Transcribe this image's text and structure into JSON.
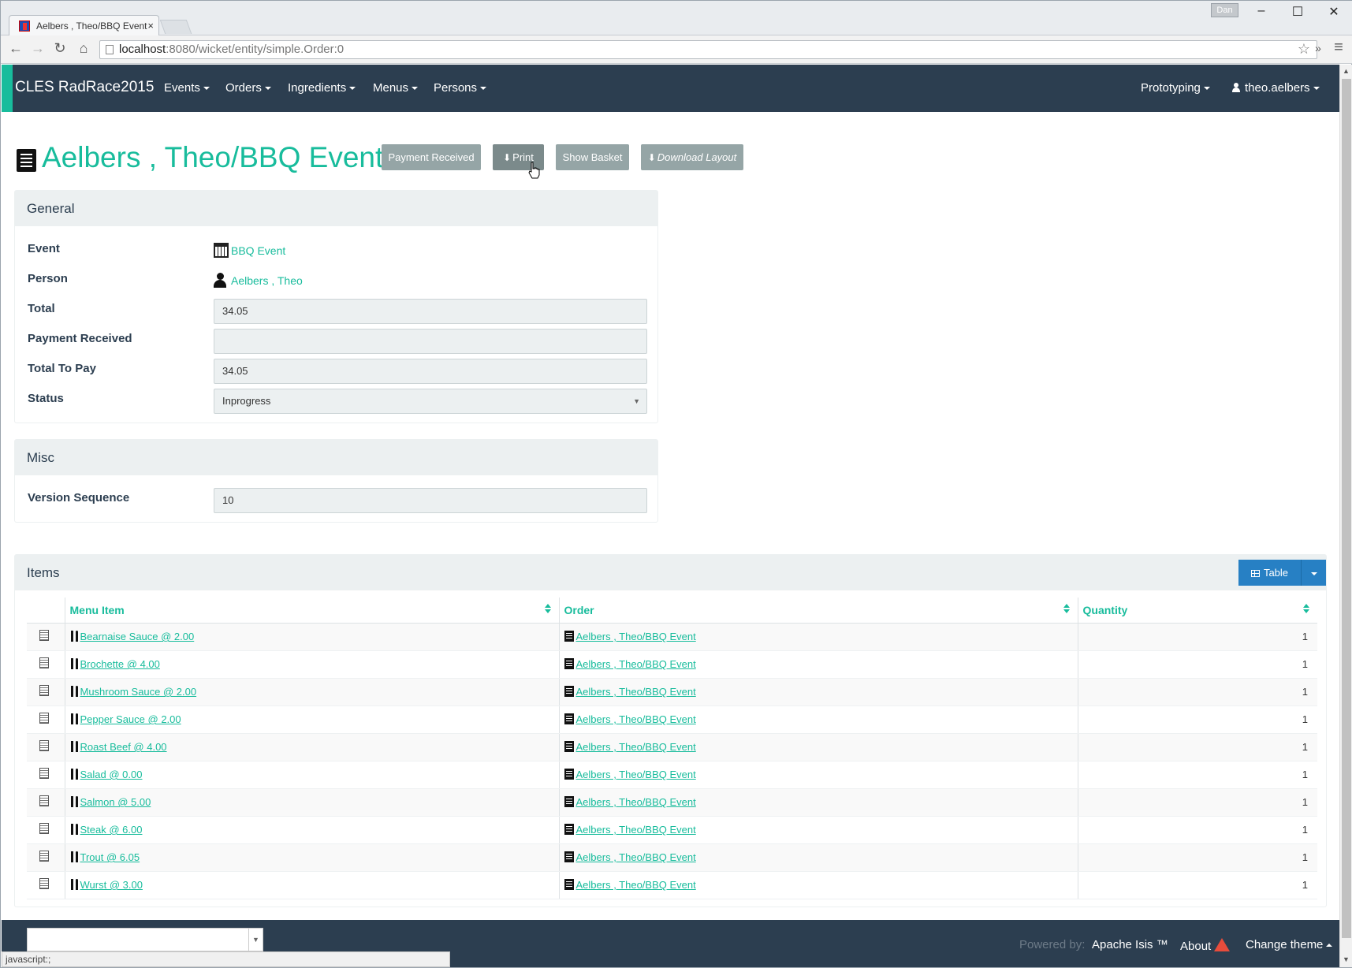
{
  "browser": {
    "tab_title": "Aelbers , Theo/BBQ Event",
    "tab_close": "×",
    "profile_name": "Dan",
    "url_host": "localhost",
    "url_path": ":8080/wicket/entity/simple.Order:0",
    "overflow": "»",
    "menu": "≡",
    "status_text": "javascript:;"
  },
  "nav": {
    "brand": "CLES RadRace2015",
    "menus": [
      "Events",
      "Orders",
      "Ingredients",
      "Menus",
      "Persons"
    ],
    "prototyping": "Prototyping",
    "user": "theo.aelbers"
  },
  "header": {
    "title": "Aelbers , Theo/BBQ Event",
    "actions": {
      "payment_received": "Payment Received",
      "print": "Print",
      "show_basket": "Show Basket",
      "download_layout": "Download Layout"
    }
  },
  "general": {
    "heading": "General",
    "event_label": "Event",
    "event_value": "BBQ Event",
    "person_label": "Person",
    "person_value": "Aelbers , Theo",
    "total_label": "Total",
    "total_value": "34.05",
    "payment_label": "Payment Received",
    "payment_value": "",
    "total_to_pay_label": "Total To Pay",
    "total_to_pay_value": "34.05",
    "status_label": "Status",
    "status_value": "Inprogress"
  },
  "misc": {
    "heading": "Misc",
    "version_label": "Version Sequence",
    "version_value": "10"
  },
  "items": {
    "heading": "Items",
    "view_button": "Table",
    "columns": [
      "Menu Item",
      "Order",
      "Quantity"
    ],
    "rows": [
      {
        "menu_item": "Bearnaise Sauce @ 2.00",
        "order": "Aelbers , Theo/BBQ Event",
        "quantity": "1"
      },
      {
        "menu_item": "Brochette @ 4.00",
        "order": "Aelbers , Theo/BBQ Event",
        "quantity": "1"
      },
      {
        "menu_item": "Mushroom Sauce @ 2.00",
        "order": "Aelbers , Theo/BBQ Event",
        "quantity": "1"
      },
      {
        "menu_item": "Pepper Sauce @ 2.00",
        "order": "Aelbers , Theo/BBQ Event",
        "quantity": "1"
      },
      {
        "menu_item": "Roast Beef @ 4.00",
        "order": "Aelbers , Theo/BBQ Event",
        "quantity": "1"
      },
      {
        "menu_item": "Salad @ 0.00",
        "order": "Aelbers , Theo/BBQ Event",
        "quantity": "1"
      },
      {
        "menu_item": "Salmon @ 5.00",
        "order": "Aelbers , Theo/BBQ Event",
        "quantity": "1"
      },
      {
        "menu_item": "Steak @ 6.00",
        "order": "Aelbers , Theo/BBQ Event",
        "quantity": "1"
      },
      {
        "menu_item": "Trout @ 6.05",
        "order": "Aelbers , Theo/BBQ Event",
        "quantity": "1"
      },
      {
        "menu_item": "Wurst @ 3.00",
        "order": "Aelbers , Theo/BBQ Event",
        "quantity": "1"
      }
    ]
  },
  "footer": {
    "powered_by": "Powered by:",
    "apache": "Apache Isis ™",
    "about": "About",
    "change_theme": "Change theme"
  }
}
